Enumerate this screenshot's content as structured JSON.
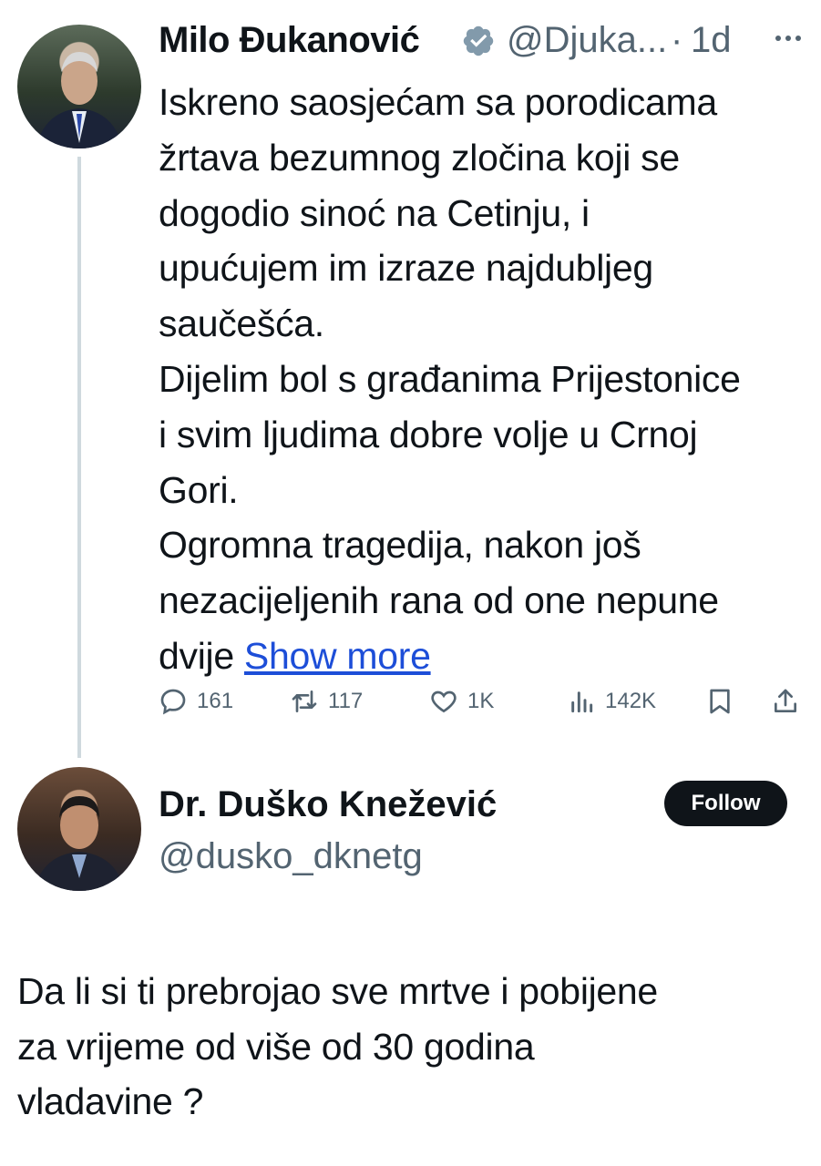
{
  "tweet": {
    "author_name": "Milo Đukanović",
    "author_handle": "@Djuka...",
    "separator": "·",
    "time": "1d",
    "text_lines": [
      "Iskreno saosjećam sa  porodicama",
      "žrtava bezumnog zločina koji se",
      "dogodio sinoć na Cetinju, i",
      "upućujem im izraze najdubljeg",
      "saučešća.",
      "Dijelim bol s građanima Prijestonice",
      "i svim ljudima dobre volje u Crnoj",
      "Gori.",
      "Ogromna tragedija, nakon još",
      "nezacijeljenih rana od one nepune"
    ],
    "last_line_text": "dvije ",
    "show_more": "Show more",
    "stats": {
      "replies": "161",
      "retweets": "117",
      "likes": "1K",
      "views": "142K"
    }
  },
  "reply": {
    "author_name": "Dr. Duško Knežević",
    "author_handle": "@dusko_dknetg",
    "follow_label": "Follow",
    "text_lines": [
      "Da li si ti prebrojao sve mrtve i pobijene",
      "za vrijeme od više od 30 godina",
      "vladavine ?"
    ]
  },
  "colors": {
    "text": "#0f1419",
    "secondary": "#536471",
    "verified": "#829aab",
    "link": "#1d4ed8",
    "follow_bg": "#0f1419"
  }
}
